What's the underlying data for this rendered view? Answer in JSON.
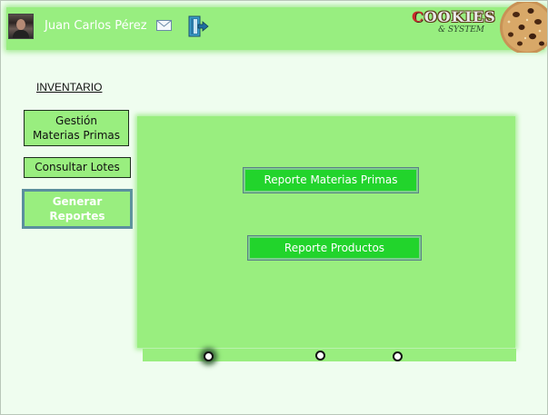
{
  "header": {
    "user_name": "Juan Carlos Pérez",
    "icons": {
      "avatar": "user-avatar",
      "mail": "mail-icon",
      "logout": "logout-door-icon"
    },
    "logo": {
      "title_prefix": "C",
      "title_rest": "OOKIES",
      "subtitle": "& SYSTEM"
    }
  },
  "sidebar": {
    "heading": "INVENTARIO",
    "items": [
      {
        "label_line1": "Gestión",
        "label_line2": "Materias Primas",
        "active": false
      },
      {
        "label": "Consultar Lotes",
        "active": false
      },
      {
        "label_line1": "Generar",
        "label_line2": "Reportes",
        "active": true
      }
    ]
  },
  "main": {
    "buttons": [
      {
        "label": "Reporte Materias Primas"
      },
      {
        "label": "Reporte Productos"
      }
    ]
  },
  "pager": {
    "dots": 3,
    "active_index": 0
  },
  "colors": {
    "accent_green": "#99ee7f",
    "button_green": "#22d42c",
    "background": "#effdef"
  }
}
